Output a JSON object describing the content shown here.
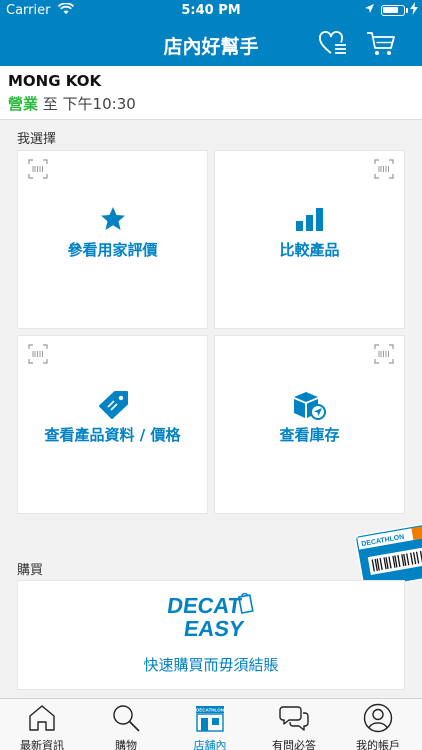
{
  "status_bar": {
    "carrier": "Carrier",
    "time": "5:40 PM",
    "battery_level": 0.8
  },
  "header": {
    "title": "店內好幫手",
    "wishlist_icon": "heart-list-icon",
    "cart_icon": "cart-icon"
  },
  "store": {
    "name": "MONG KOK",
    "open_label": "營業",
    "hours": " 至 下午10:30"
  },
  "choices": {
    "section_label": "我選擇",
    "tiles": [
      {
        "label": "參看用家評價",
        "icon": "star-icon"
      },
      {
        "label": "比較產品",
        "icon": "bar-chart-icon"
      },
      {
        "label": "查看產品資料 / 價格",
        "icon": "price-tag-icon"
      },
      {
        "label": "查看庫存",
        "icon": "box-locate-icon"
      }
    ]
  },
  "buy": {
    "section_label": "購買",
    "logo_line1": "DECAT",
    "logo_line2": "EASY",
    "label": "快速購買而毋須結賬",
    "card_brand": "DECATHLON"
  },
  "tab_bar": {
    "active_index": 2,
    "store_badge": "DECATHLON",
    "tabs": [
      {
        "label": "最新資訊",
        "icon": "home-icon"
      },
      {
        "label": "購物",
        "icon": "search-icon"
      },
      {
        "label": "店舖內",
        "icon": "store-icon"
      },
      {
        "label": "有問必答",
        "icon": "chat-bubbles-icon"
      },
      {
        "label": "我的帳戶",
        "icon": "account-icon"
      }
    ]
  },
  "colors": {
    "brand_blue": "#0082c3",
    "open_green": "#2dbb3f"
  }
}
